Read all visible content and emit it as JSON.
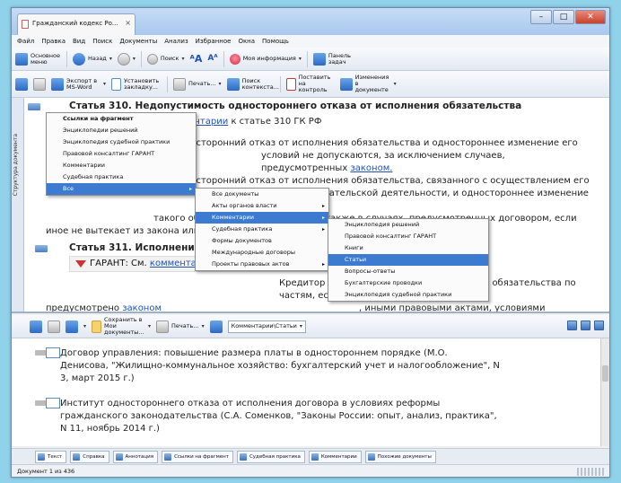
{
  "tab_title": "Гражданский кодекс Ро...",
  "window_buttons": {
    "min": "–",
    "max": "□",
    "close": "✕"
  },
  "menu": [
    "Файл",
    "Правка",
    "Вид",
    "Поиск",
    "Документы",
    "Анализ",
    "Избранное",
    "Окна",
    "Помощь"
  ],
  "toolbar1": {
    "main_menu": "Основное меню",
    "back": "Назад",
    "search": "Поиск",
    "my_info": "Моя информация",
    "panel": "Панель задач"
  },
  "toolbar2": {
    "export": "Экспорт в MS-Word",
    "bookmark": "Установить закладку...",
    "print": "Печать...",
    "context_search": "Поиск контекста...",
    "control": "Поставить на контроль",
    "changes": "Изменения в документе"
  },
  "document": {
    "article310_title": "Статья 310. Недопустимость одностороннего отказа от исполнения обязательства",
    "garant_link_prefix": "См.",
    "garant_link": "комментарии",
    "garant_link_suffix": "к статье 310 ГК РФ",
    "p1_line1": "Односторонний отказ от исполнения обязательства и одностороннее изменение его",
    "p1_line2a": "условий не допускаются, за исключением случаев, предусмотренных",
    "p1_line2_link": "законом.",
    "p1_line3": "Односторонний отказ от исполнения обязательства, связанного с осуществлением его",
    "p1_line4": "сторонами предпринимательской деятельности, и одностороннее изменение условий",
    "p1_line5": "такого обязательства допускаются также в случаях, предусмотренных договором, если",
    "p1_line6": "иное не вытекает из закона или существа обязательства.",
    "article311_title": "Статья 311. Исполнение обязательства по частям",
    "garant2_label": "ГАРАНТ:",
    "garant2_prefix": "См.",
    "garant2_link": "комментарии",
    "p2_line1": "Кредитор вправе не принимать исполнения обязательства по частям, если иное не",
    "p2_line2a": "предусмотрено",
    "p2_line2_link": "законом",
    "p2_line2b": ", иными правовыми актами, условиями обязательства и не",
    "side_tab": "Структура документа"
  },
  "popup1": {
    "items": [
      "Ссылки на фрагмент",
      "Энциклопедии решений",
      "Энциклопедия судебной практики",
      "Правовой консалтинг ГАРАНТ",
      "Комментарии",
      "Судебная практика",
      "Все"
    ]
  },
  "popup2": {
    "items": [
      "Все документы",
      "Акты органов власти",
      "Комментарии",
      "Судебная практика",
      "Формы документов",
      "Международные договоры",
      "Проекты правовых актов"
    ]
  },
  "popup3": {
    "items": [
      "Энциклопедия решений",
      "Правовой консалтинг ГАРАНТ",
      "Книги",
      "Статьи",
      "Вопросы-ответы",
      "Бухгалтерские проводки",
      "Энциклопедия судебной практики"
    ]
  },
  "lower_toolbar": {
    "save": "Сохранить в Мои документы...",
    "print": "Печать...",
    "filter": "Комментарии\\Статьи"
  },
  "list": [
    {
      "line1": "Договор управления: повышение размера платы в одностороннем порядке (М.О.",
      "line2": "Денисова, \"Жилищно-коммунальное хозяйство: бухгалтерский учет и налогообложение\", N",
      "line3": "3, март 2015 г.)"
    },
    {
      "line1": "Институт одностороннего отказа от исполнения договора в условиях реформы",
      "line2": "гражданского законодательства (С.А. Соменков, \"Законы России: опыт, анализ, практика\",",
      "line3": "N 11, ноябрь 2014 г.)"
    }
  ],
  "bottom_tabs": [
    "Текст",
    "Справка",
    "Аннотация",
    "Ссылки на фрагмент",
    "Судебная практика",
    "Комментарии",
    "Похожие документы"
  ],
  "status": "Документ 1 из 436"
}
